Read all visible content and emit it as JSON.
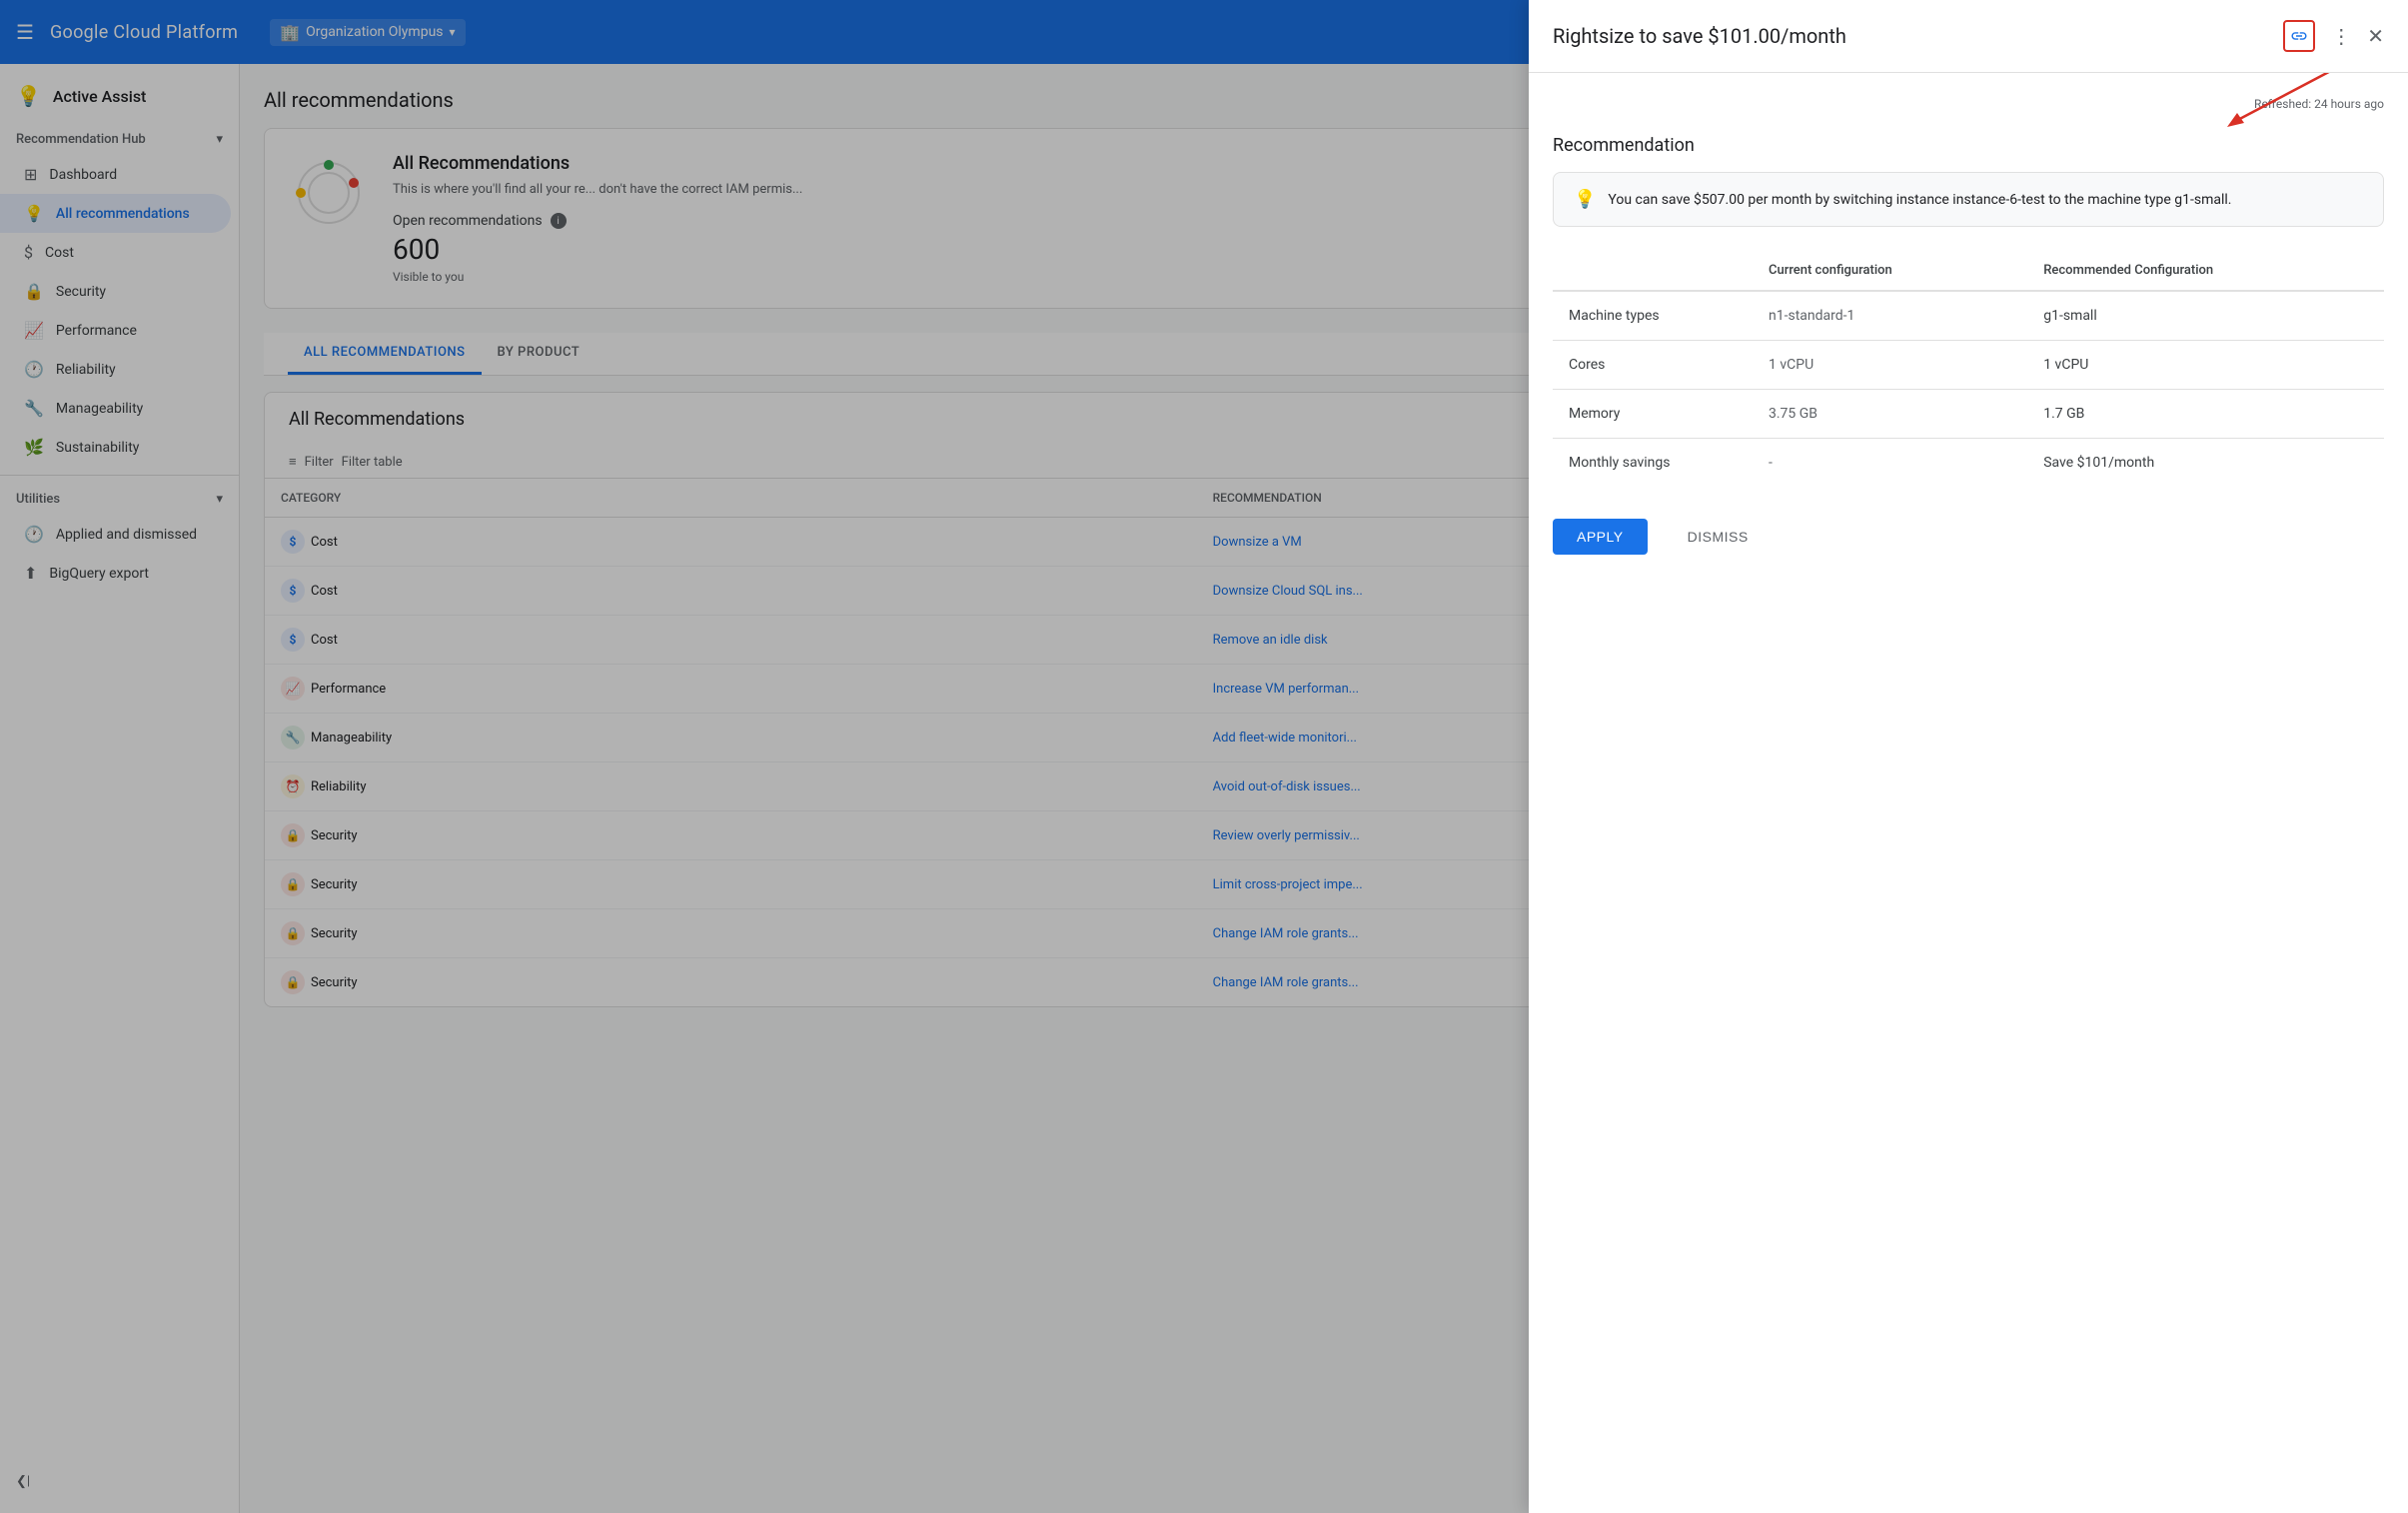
{
  "header": {
    "hamburger_label": "☰",
    "logo": "Google Cloud Platform",
    "org": {
      "icon": "🏢",
      "name": "Organization Olympus",
      "chevron": "▾"
    }
  },
  "sidebar": {
    "active_assist_label": "Active Assist",
    "bulb_icon": "💡",
    "recommendation_hub_label": "Recommendation Hub",
    "chevron": "▾",
    "items": [
      {
        "id": "dashboard",
        "label": "Dashboard",
        "icon": "⊞"
      },
      {
        "id": "all-recommendations",
        "label": "All recommendations",
        "icon": "💡",
        "active": true
      },
      {
        "id": "cost",
        "label": "Cost",
        "icon": "$"
      },
      {
        "id": "security",
        "label": "Security",
        "icon": "🔒"
      },
      {
        "id": "performance",
        "label": "Performance",
        "icon": "📈"
      },
      {
        "id": "reliability",
        "label": "Reliability",
        "icon": "🕐"
      },
      {
        "id": "manageability",
        "label": "Manageability",
        "icon": "🔧"
      },
      {
        "id": "sustainability",
        "label": "Sustainability",
        "icon": "🌿"
      }
    ],
    "utilities_label": "Utilities",
    "utilities_chevron": "▾",
    "utilities_items": [
      {
        "id": "applied-dismissed",
        "label": "Applied and dismissed",
        "icon": "🕐"
      },
      {
        "id": "bigquery-export",
        "label": "BigQuery export",
        "icon": "⬆"
      }
    ],
    "collapse_label": "❮|"
  },
  "main": {
    "title": "All recommendations",
    "card": {
      "title": "All Recommendations",
      "description": "This is where you'll find all your re... don't have the correct IAM permis...",
      "open_recs_label": "Open recommendations",
      "open_recs_count": "600",
      "visible_label": "Visible to you"
    },
    "tabs": [
      {
        "id": "all",
        "label": "ALL RECOMMENDATIONS",
        "active": true
      },
      {
        "id": "by-product",
        "label": "BY PRODUCT"
      }
    ],
    "rec_table": {
      "title": "All Recommendations",
      "filter_label": "Filter",
      "filter_table_label": "Filter table",
      "columns": [
        "Category",
        "Recommendation"
      ],
      "rows": [
        {
          "category": "Cost",
          "category_type": "cost",
          "recommendation": "Downsize a VM"
        },
        {
          "category": "Cost",
          "category_type": "cost",
          "recommendation": "Downsize Cloud SQL ins..."
        },
        {
          "category": "Cost",
          "category_type": "cost",
          "recommendation": "Remove an idle disk"
        },
        {
          "category": "Performance",
          "category_type": "perf",
          "recommendation": "Increase VM performan..."
        },
        {
          "category": "Manageability",
          "category_type": "manage",
          "recommendation": "Add fleet-wide monitori..."
        },
        {
          "category": "Reliability",
          "category_type": "reliability",
          "recommendation": "Avoid out-of-disk issues..."
        },
        {
          "category": "Security",
          "category_type": "security",
          "recommendation": "Review overly permissiv..."
        },
        {
          "category": "Security",
          "category_type": "security",
          "recommendation": "Limit cross-project impe..."
        },
        {
          "category": "Security",
          "category_type": "security",
          "recommendation": "Change IAM role grants..."
        },
        {
          "category": "Security",
          "category_type": "security",
          "recommendation": "Change IAM role grants..."
        }
      ]
    }
  },
  "detail_panel": {
    "title": "Rightsize to save $101.00/month",
    "refreshed_text": "Refreshed: 24 hours ago",
    "section_title": "Recommendation",
    "savings_banner": "You can save $507.00 per month by switching instance instance-6-test to the machine type g1-small.",
    "table": {
      "headers": [
        "",
        "Current configuration",
        "Recommended Configuration"
      ],
      "rows": [
        {
          "label": "Machine types",
          "current": "n1-standard-1",
          "recommended": "g1-small"
        },
        {
          "label": "Cores",
          "current": "1 vCPU",
          "recommended": "1 vCPU"
        },
        {
          "label": "Memory",
          "current": "3.75 GB",
          "recommended": "1.7 GB"
        },
        {
          "label": "Monthly savings",
          "current": "-",
          "recommended": "Save $101/month"
        }
      ]
    },
    "apply_label": "APPLY",
    "dismiss_label": "DISMISS"
  }
}
